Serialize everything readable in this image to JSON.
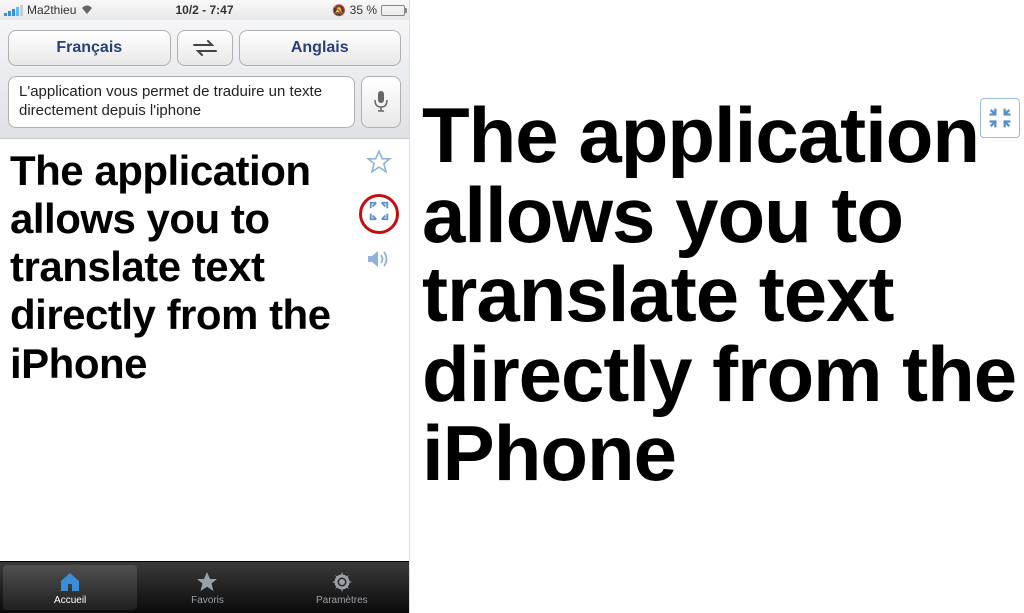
{
  "statusBar": {
    "carrier": "Ma2thieu",
    "time": "10/2 - 7:47",
    "batteryPercent": "35 %"
  },
  "langRow": {
    "source": "Français",
    "target": "Anglais"
  },
  "input": {
    "text": "L'application vous permet de traduire un texte directement depuis l'iphone"
  },
  "result": {
    "text": "The application allows you to translate text directly from the iPhone"
  },
  "tabs": {
    "home": "Accueil",
    "favorites": "Favoris",
    "settings": "Paramètres"
  },
  "fullscreen": {
    "text": "The application allows you to translate text directly from the iPhone"
  }
}
